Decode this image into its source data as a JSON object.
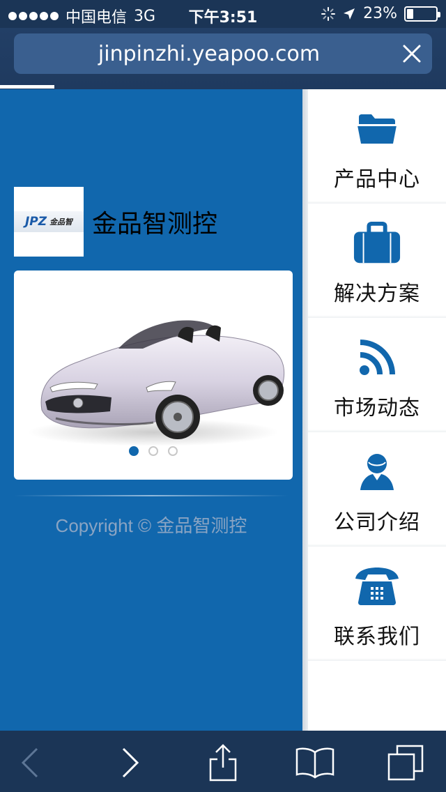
{
  "status": {
    "carrier": "中国电信",
    "network": "3G",
    "time": "下午3:51",
    "battery": "23%",
    "battery_level": 0.23
  },
  "browser": {
    "url": "jinpinzhi.yeapoo.com",
    "close_icon": "close-icon"
  },
  "site": {
    "logo_mark": "JPZ",
    "logo_cn": "金品智",
    "name": "金品智测控",
    "copyright": "Copyright © 金品智测控"
  },
  "slider": {
    "active_index": 0,
    "count": 3
  },
  "menu": {
    "items": [
      {
        "label": "产品中心",
        "icon": "folder-icon"
      },
      {
        "label": "解决方案",
        "icon": "briefcase-icon"
      },
      {
        "label": "市场动态",
        "icon": "rss-icon"
      },
      {
        "label": "公司介绍",
        "icon": "user-icon"
      },
      {
        "label": "联系我们",
        "icon": "phone-icon"
      }
    ]
  },
  "colors": {
    "brand_blue": "#1167ad",
    "bar_dark": "#1b3556"
  }
}
